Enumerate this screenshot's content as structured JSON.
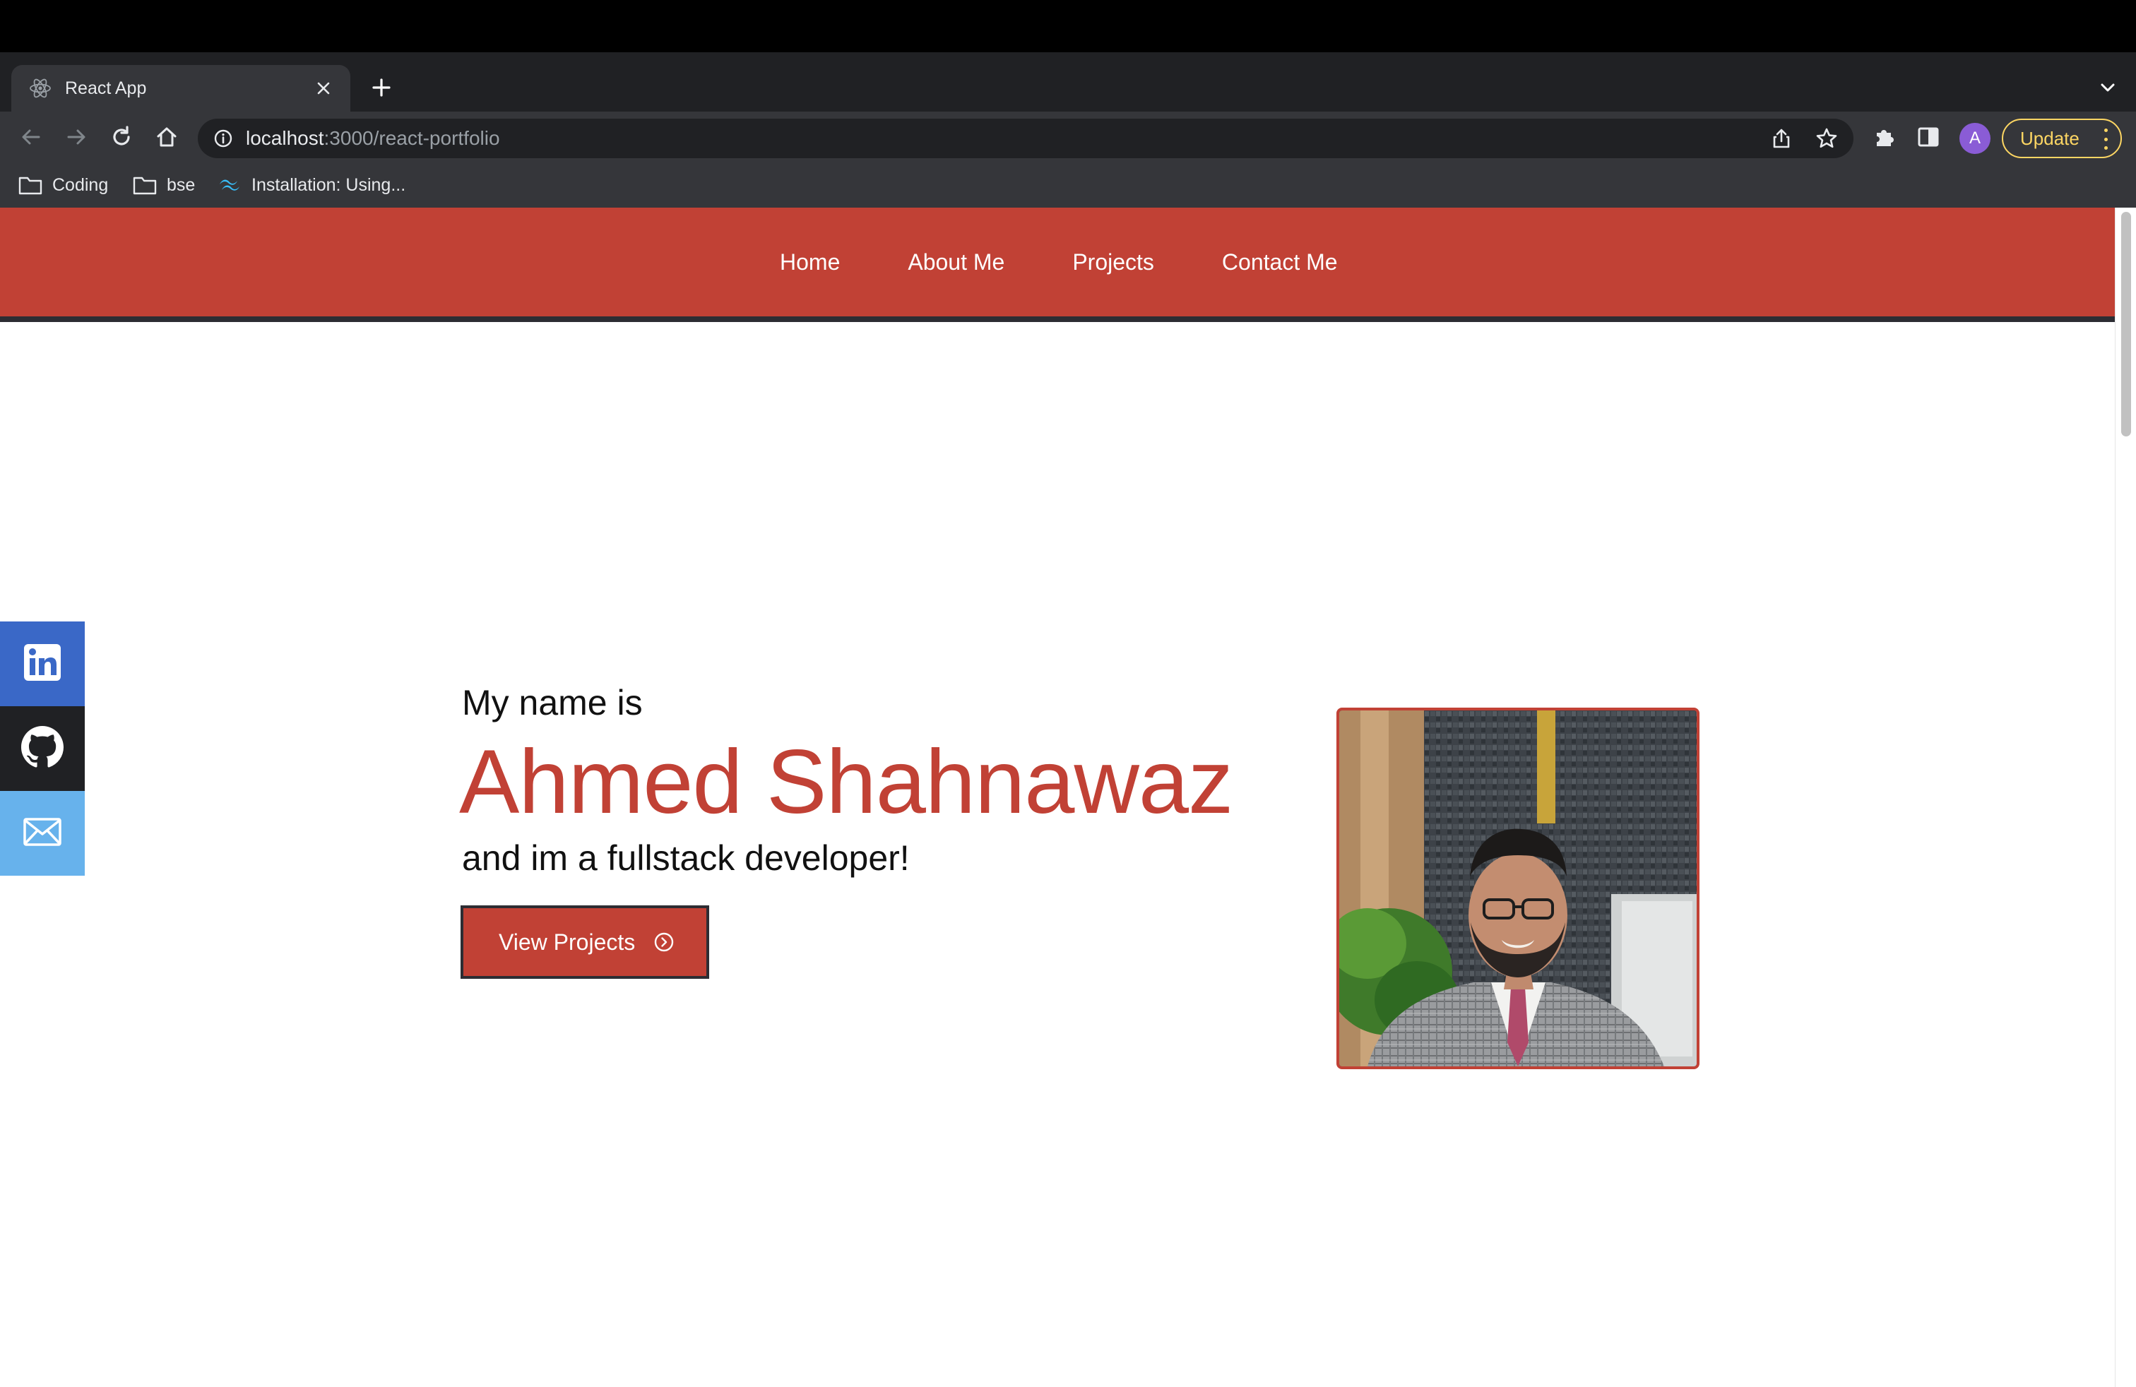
{
  "browser": {
    "tab_title": "React App",
    "url_host": "localhost",
    "url_rest": ":3000/react-portfolio",
    "profile_initial": "A",
    "update_label": "Update",
    "bookmarks": [
      {
        "label": "Coding",
        "icon": "folder-icon"
      },
      {
        "label": "bse",
        "icon": "folder-icon"
      },
      {
        "label": "Installation: Using...",
        "icon": "tailwind-icon"
      }
    ]
  },
  "nav": {
    "items": [
      {
        "label": "Home"
      },
      {
        "label": "About Me"
      },
      {
        "label": "Projects"
      },
      {
        "label": "Contact Me"
      }
    ]
  },
  "social": [
    {
      "icon": "linkedin-icon",
      "color": "#3a68c7"
    },
    {
      "icon": "github-icon",
      "color": "#202124"
    },
    {
      "icon": "mail-icon",
      "color": "#67b2ec"
    }
  ],
  "hero": {
    "intro": "My name is",
    "name": "Ahmed Shahnawaz",
    "tagline": "and im a fullstack developer!",
    "cta_label": "View Projects",
    "cta_icon": "chevron-circle-right-icon",
    "photo": "profile-photo"
  },
  "colors": {
    "accent": "#c14135",
    "dark": "#2d2d33",
    "linkedin": "#3a68c7",
    "github": "#202124",
    "mail": "#67b2ec"
  }
}
